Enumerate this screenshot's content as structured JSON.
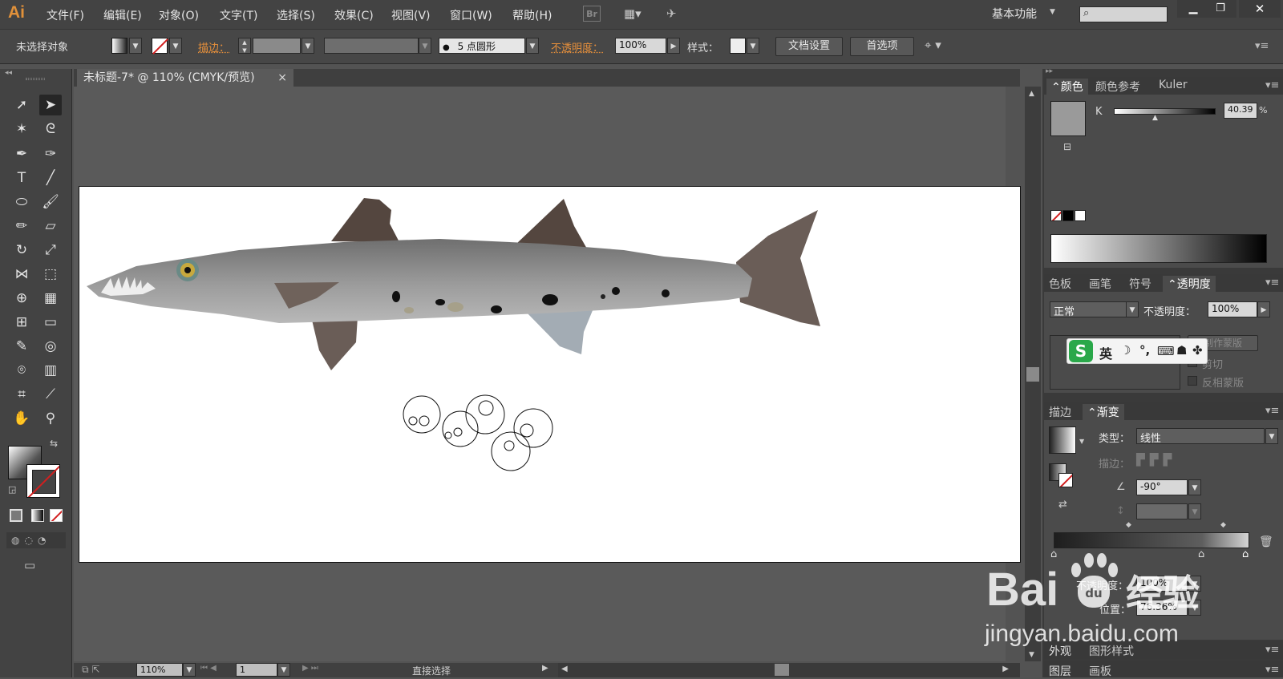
{
  "app": {
    "logo": "Ai"
  },
  "menu": [
    "文件(F)",
    "编辑(E)",
    "对象(O)",
    "文字(T)",
    "选择(S)",
    "效果(C)",
    "视图(V)",
    "窗口(W)",
    "帮助(H)"
  ],
  "menu_right": {
    "br_badge": "Br",
    "workspace": "基本功能",
    "search_placeholder": ""
  },
  "control": {
    "selection": "未选择对象",
    "stroke_label": "描边：",
    "brush_dot": "●",
    "brush_value": "5 点圆形",
    "opacity_label": "不透明度：",
    "opacity_value": "100%",
    "style_label": "样式：",
    "doc_setup": "文档设置",
    "preferences": "首选项"
  },
  "document": {
    "tab_title": "未标题-7* @ 110% (CMYK/预览)",
    "close": "×"
  },
  "status": {
    "zoom": "110%",
    "page": "1",
    "tool_name": "直接选择"
  },
  "color_panel": {
    "tabs": [
      "颜色",
      "颜色参考",
      "Kuler"
    ],
    "channel": "K",
    "value": "40.39",
    "unit": "%",
    "k_level_percent": 40.39
  },
  "transparency_panel": {
    "tabs": [
      "色板",
      "画笔",
      "符号",
      "透明度"
    ],
    "blend_mode": "正常",
    "opacity_label": "不透明度：",
    "opacity_value": "100%",
    "make_mask": "制作蒙版",
    "clip": "剪切",
    "invert_mask": "反相蒙版"
  },
  "gradient_panel": {
    "tabs": [
      "描边",
      "渐变"
    ],
    "type_label": "类型：",
    "type_value": "线性",
    "stroke_label": "描边：",
    "angle_value": "-90°",
    "opacity_label": "不透明度：",
    "opacity_value": "100%",
    "position_label": "位置：",
    "position_value": "76.36%"
  },
  "bottom_panels": {
    "appearance_tabs": [
      "外观",
      "图形样式"
    ],
    "layers_tabs": [
      "图层",
      "画板"
    ]
  },
  "ime_bar": {
    "logo": "S",
    "mode": "英"
  },
  "watermark": {
    "main": "Bai",
    "paw": "du",
    "cn": "经验",
    "url": "jingyan.baidu.com"
  },
  "colors": {
    "accent_orange": "#e58f3b",
    "ui_dark": "#434343",
    "canvas_bg": "#5a5a5a",
    "fin_brown": "#6a5d57",
    "fish_gray": "#9a9a9a"
  }
}
